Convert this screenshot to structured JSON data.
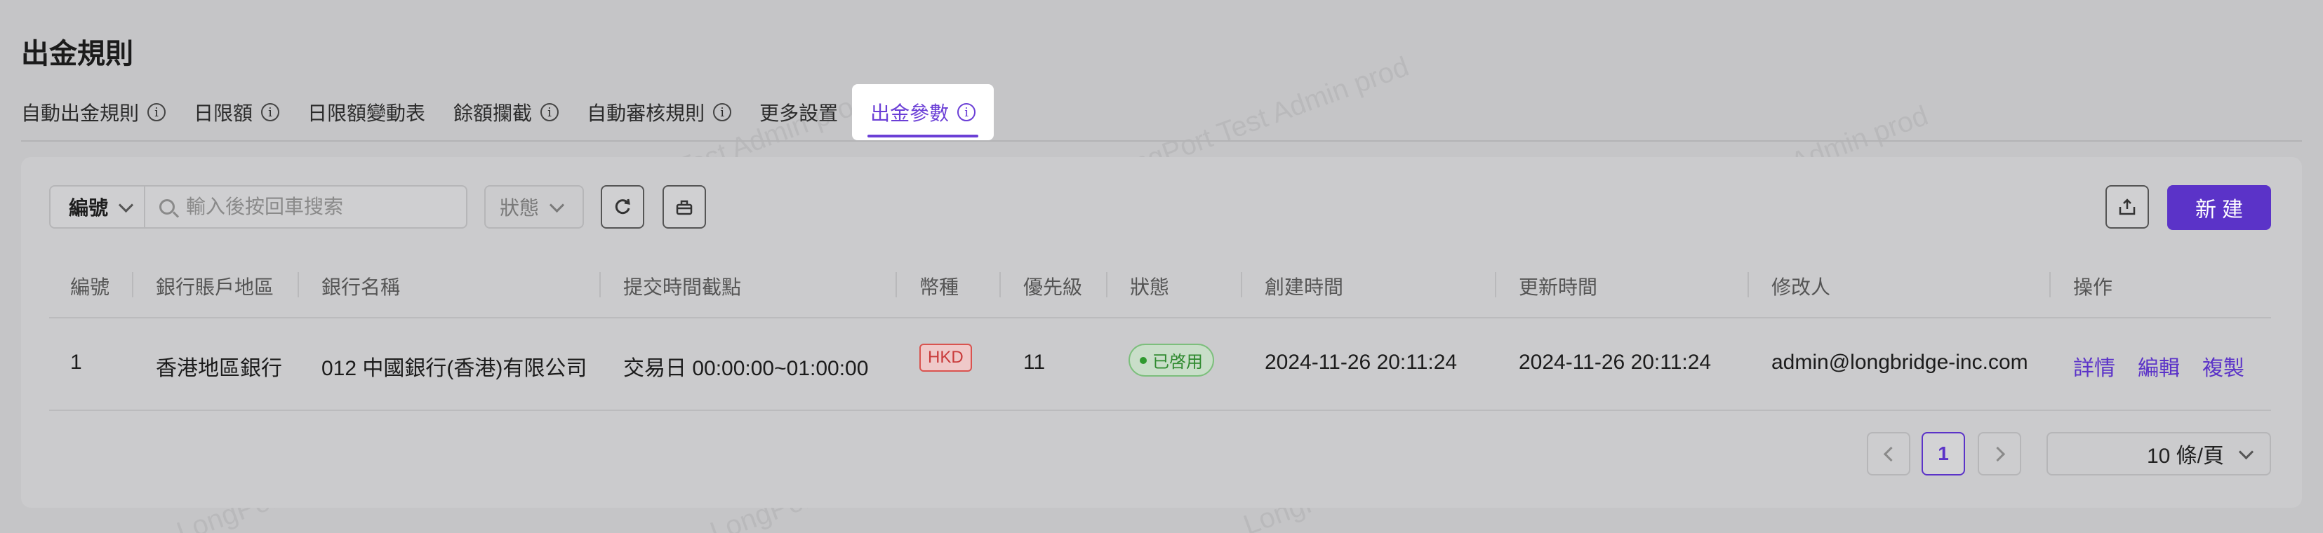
{
  "page": {
    "title": "出金規則"
  },
  "tabs": [
    {
      "label": "自動出金規則",
      "info": true,
      "active": false
    },
    {
      "label": "日限額",
      "info": true,
      "active": false
    },
    {
      "label": "日限額變動表",
      "info": false,
      "active": false
    },
    {
      "label": "餘額攔截",
      "info": true,
      "active": false
    },
    {
      "label": "自動審核規則",
      "info": true,
      "active": false
    },
    {
      "label": "更多設置",
      "info": false,
      "active": false
    },
    {
      "label": "出金參數",
      "info": true,
      "active": true
    }
  ],
  "toolbar": {
    "field_select": "編號",
    "search_placeholder": "輸入後按回車搜索",
    "status_select_placeholder": "狀態",
    "new_button": "新建"
  },
  "table": {
    "columns": [
      "編號",
      "銀行賬戶地區",
      "銀行名稱",
      "提交時間截點",
      "幣種",
      "優先級",
      "狀態",
      "創建時間",
      "更新時間",
      "修改人",
      "操作"
    ],
    "rows": [
      {
        "id": "1",
        "region": "香港地區銀行",
        "bank": "012 中國銀行(香港)有限公司",
        "cutoff": "交易日 00:00:00~01:00:00",
        "currency": "HKD",
        "priority": "11",
        "status": "已啓用",
        "created": "2024-11-26 20:11:24",
        "updated": "2024-11-26 20:11:24",
        "modifier": "admin@longbridge-inc.com",
        "actions": [
          "詳情",
          "編輯",
          "複製"
        ]
      }
    ]
  },
  "pagination": {
    "current_page": "1",
    "page_size": "10 條/頁"
  },
  "watermark": "LongPort Test Admin prod",
  "colors": {
    "accent": "#5b33c8",
    "currency_tag": "#d9534f",
    "status_enabled": "#2f8a2f"
  }
}
